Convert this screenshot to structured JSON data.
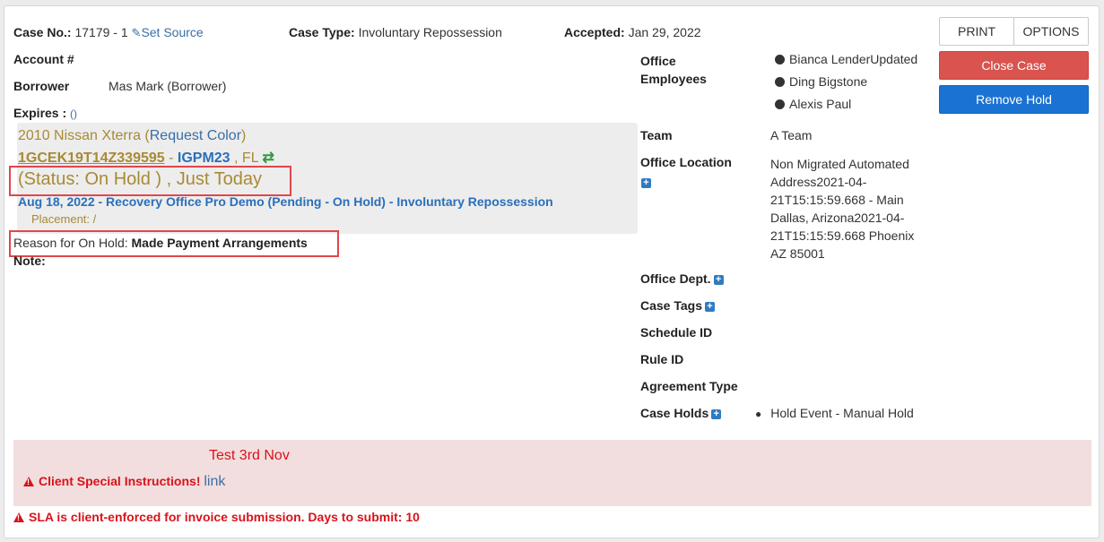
{
  "header": {
    "case_no_label": "Case No.:",
    "case_no_value": "17179 - 1",
    "set_source": "Set Source",
    "case_type_label": "Case Type:",
    "case_type_value": "Involuntary Repossession",
    "accepted_label": "Accepted:",
    "accepted_value": "Jan 29, 2022"
  },
  "account": {
    "account_label": "Account #",
    "borrower_label": "Borrower",
    "borrower_value": "Mas Mark (Borrower)",
    "expires_label": "Expires :",
    "expires_link": "()"
  },
  "vehicle": {
    "name": "2010 Nissan Xterra",
    "request_color_open": "(",
    "request_color": "Request Color",
    "request_color_close": ")",
    "vin": "1GCEK19T14Z339595",
    "separator": "-",
    "plate": "IGPM23",
    "state": ", FL",
    "status": "(Status: On Hold ) , Just Today",
    "event": "Aug 18, 2022 - Recovery Office Pro Demo (Pending - On Hold) - Involuntary Repossession",
    "placement": "Placement: /"
  },
  "hold": {
    "reason_label": "Reason for On Hold:",
    "reason_value": "Made Payment Arrangements",
    "note_label": "Note:"
  },
  "office": {
    "office_employees_label_1": "Office",
    "office_employees_label_2": "Employees",
    "employees": [
      "Bianca LenderUpdated",
      "Ding Bigstone",
      "Alexis Paul"
    ],
    "team_label": "Team",
    "team_value": "A Team",
    "location_label": "Office Location",
    "location_lines": [
      "Non Migrated Automated",
      "Address2021-04-",
      "21T15:15:59.668 - Main",
      "Dallas, Arizona2021-04-",
      "21T15:15:59.668 Phoenix",
      "AZ 85001"
    ],
    "dept_label": "Office Dept.",
    "tags_label": "Case Tags",
    "schedule_label": "Schedule ID",
    "rule_label": "Rule ID",
    "agreement_label": "Agreement Type",
    "holds_label": "Case Holds",
    "holds_item": "Hold Event - Manual Hold"
  },
  "buttons": {
    "print": "PRINT",
    "options": "OPTIONS",
    "close_case": "Close Case",
    "remove_hold": "Remove Hold"
  },
  "warnings": {
    "test_note": "Test 3rd Nov",
    "special_instructions": "Client Special Instructions!",
    "special_link": "link",
    "sla": "SLA is client-enforced for invoice submission. Days to submit: 10"
  },
  "colors": {
    "gold": "#a88a35",
    "link_blue": "#3a6ea5",
    "close_red": "#d9534f",
    "remove_blue": "#1a73d2",
    "highlight_box": "#e0474c",
    "warning_bg": "#f2dede",
    "warning_text": "#d9121b"
  },
  "icons": [
    "pencil-icon",
    "swap-icon",
    "dot-icon",
    "plus-icon",
    "warning-icon"
  ]
}
